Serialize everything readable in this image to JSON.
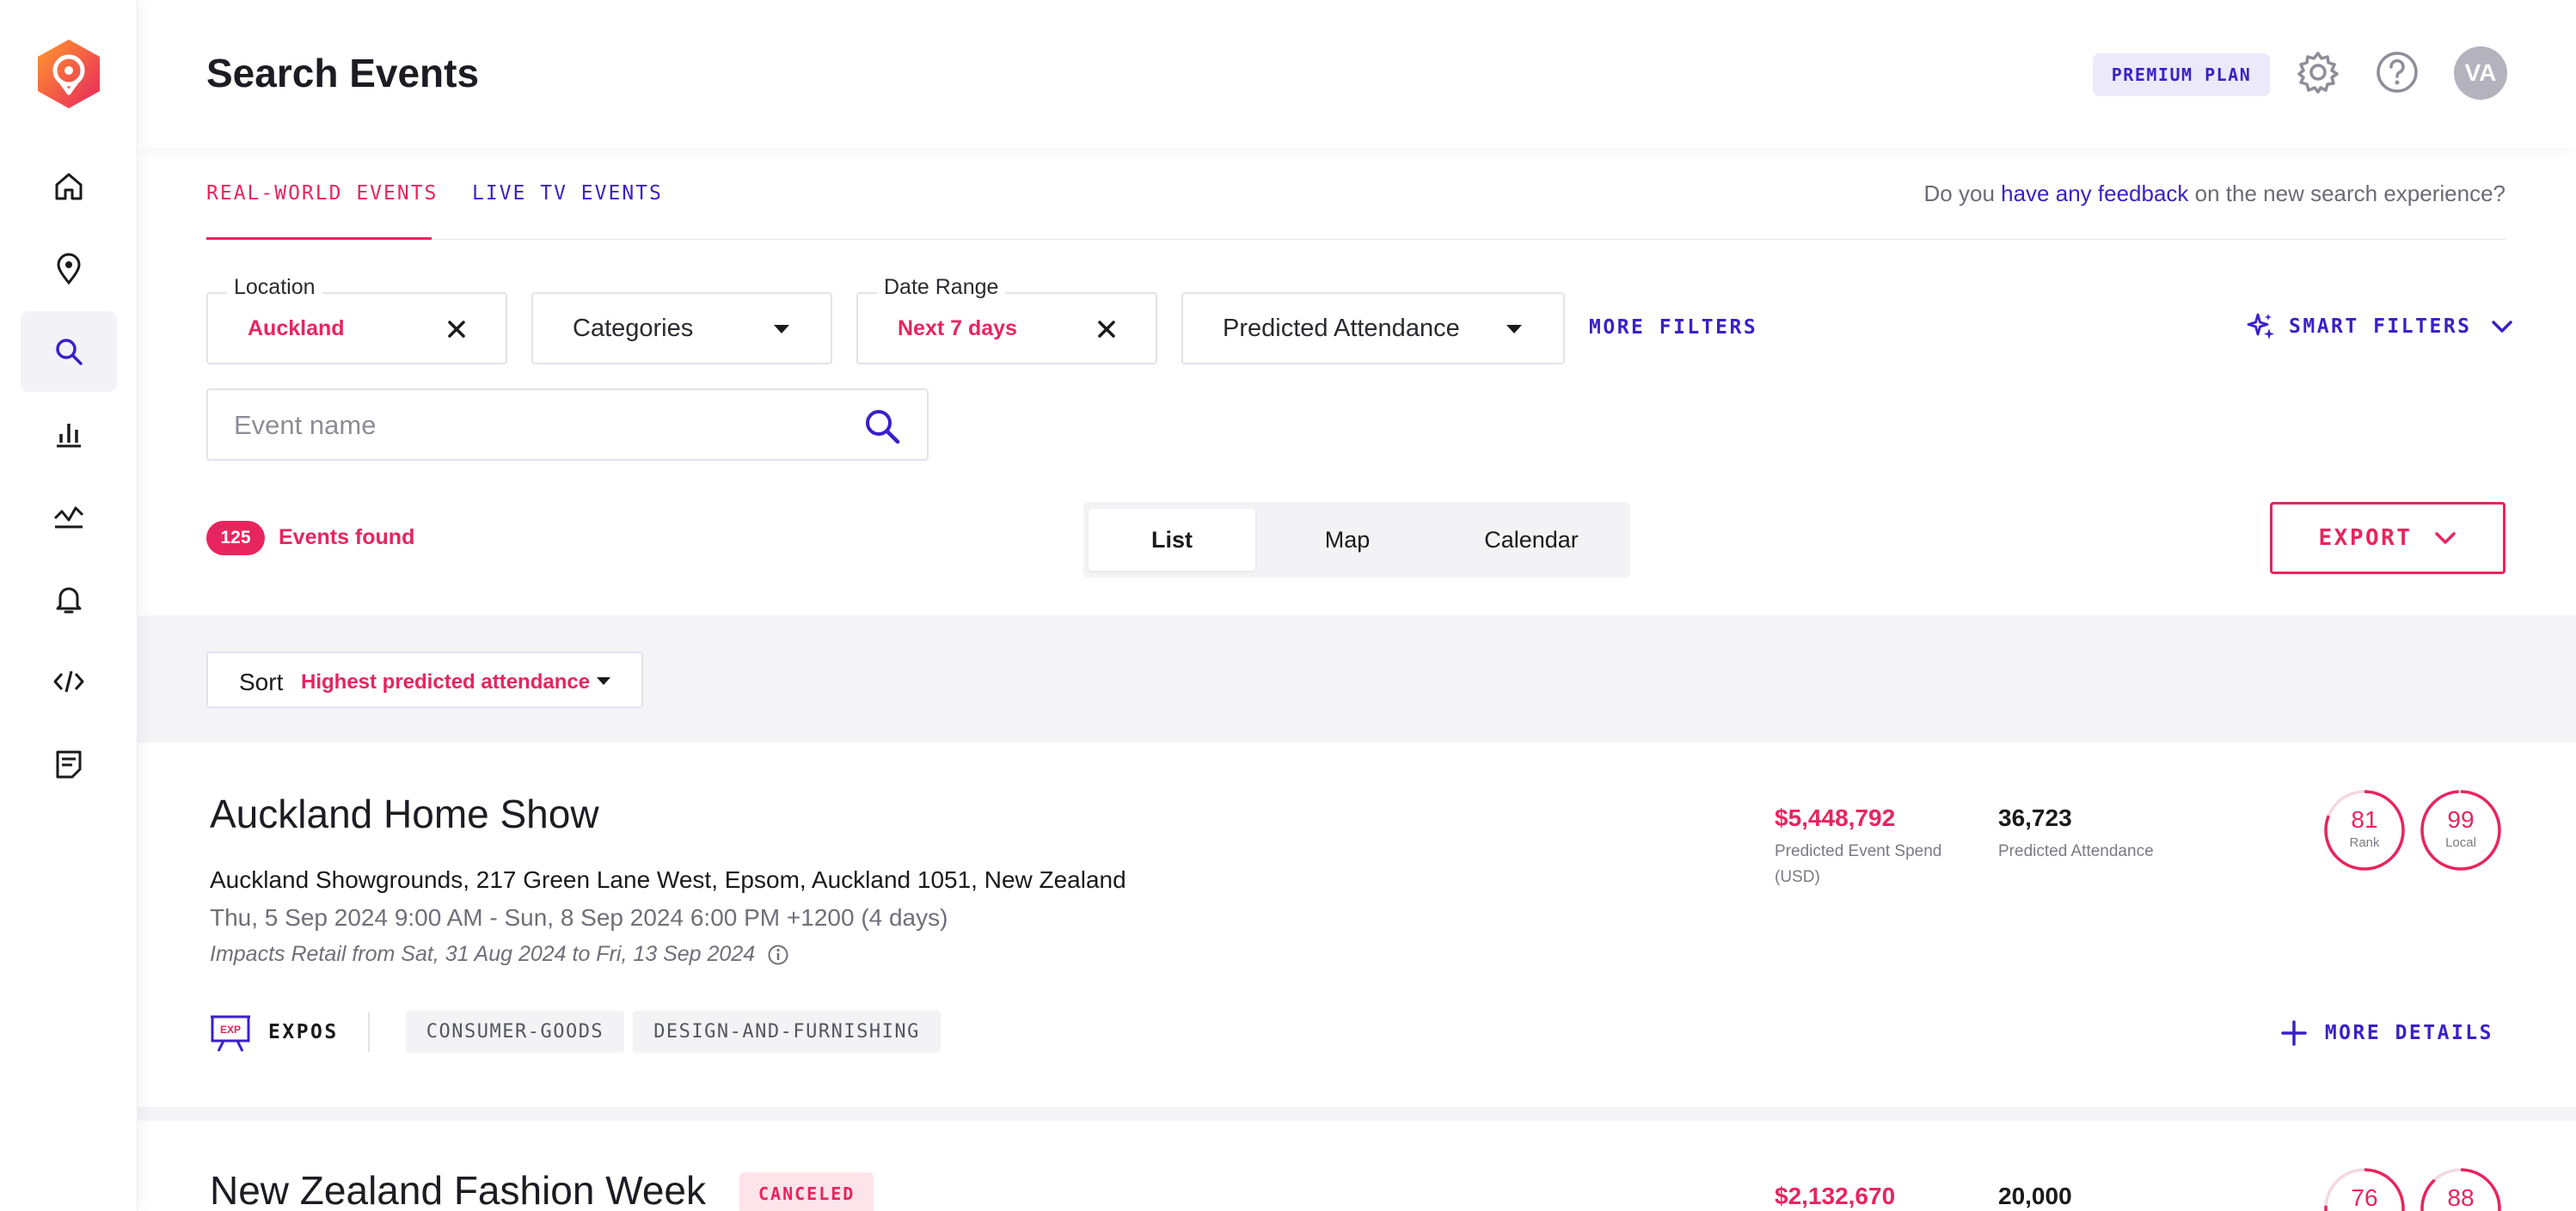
{
  "app": {
    "brand_color": "#e8245f",
    "accent_color": "#3b1fc9",
    "page_title": "Search Events",
    "plan_badge": "PREMIUM PLAN",
    "avatar_initials": "VA"
  },
  "sidebar": {
    "items": [
      {
        "name": "home",
        "icon": "home-icon",
        "active": false
      },
      {
        "name": "locations",
        "icon": "map-pin-icon",
        "active": false
      },
      {
        "name": "search",
        "icon": "search-icon",
        "active": true
      },
      {
        "name": "analytics",
        "icon": "bar-chart-icon",
        "active": false
      },
      {
        "name": "trends",
        "icon": "trend-line-icon",
        "active": false
      },
      {
        "name": "alerts",
        "icon": "bell-icon",
        "active": false
      },
      {
        "name": "api",
        "icon": "code-icon",
        "active": false
      },
      {
        "name": "notes",
        "icon": "notes-icon",
        "active": false
      }
    ]
  },
  "tabs": {
    "real_world": "REAL-WORLD EVENTS",
    "live_tv": "LIVE TV EVENTS"
  },
  "feedback": {
    "prefix": "Do you ",
    "link": "have any feedback",
    "suffix": " on the new search experience?"
  },
  "filters": {
    "location": {
      "label": "Location",
      "value": "Auckland"
    },
    "categories": {
      "placeholder": "Categories"
    },
    "date_range": {
      "label": "Date Range",
      "value": "Next 7 days"
    },
    "attendance": {
      "placeholder": "Predicted Attendance"
    },
    "more_filters": "MORE FILTERS",
    "smart_filters": "SMART FILTERS"
  },
  "event_search": {
    "placeholder": "Event name"
  },
  "results": {
    "count": "125",
    "label": "Events found"
  },
  "views": {
    "list": "List",
    "map": "Map",
    "calendar": "Calendar",
    "selected": "List"
  },
  "export": {
    "label": "EXPORT"
  },
  "sort": {
    "label": "Sort",
    "value": "Highest predicted attendance"
  },
  "events": [
    {
      "title": "Auckland Home Show",
      "venue": "Auckland Showgrounds, 217 Green Lane West, Epsom, Auckland 1051, New Zealand",
      "dates": "Thu, 5 Sep 2024 9:00 AM - Sun, 8 Sep 2024 6:00 PM +1200 (4 days)",
      "impact": "Impacts Retail from Sat, 31 Aug 2024 to Fri, 13 Sep 2024",
      "spend": "$5,448,792",
      "spend_label_1": "Predicted Event Spend",
      "spend_label_2": "(USD)",
      "attendance": "36,723",
      "attendance_label": "Predicted Attendance",
      "rank": "81",
      "rank_label": "Rank",
      "rank_fraction": 0.81,
      "local": "99",
      "local_label": "Local",
      "local_fraction": 0.99,
      "category_badge": "EXP",
      "category": "EXPOS",
      "tags": [
        "CONSUMER-GOODS",
        "DESIGN-AND-FURNISHING"
      ],
      "more_details": "MORE DETAILS"
    },
    {
      "title": "New Zealand Fashion Week",
      "status": "CANCELED",
      "spend": "$2,132,670",
      "attendance": "20,000",
      "rank": "76",
      "rank_fraction": 0.76,
      "local": "88",
      "local_fraction": 0.88
    }
  ]
}
